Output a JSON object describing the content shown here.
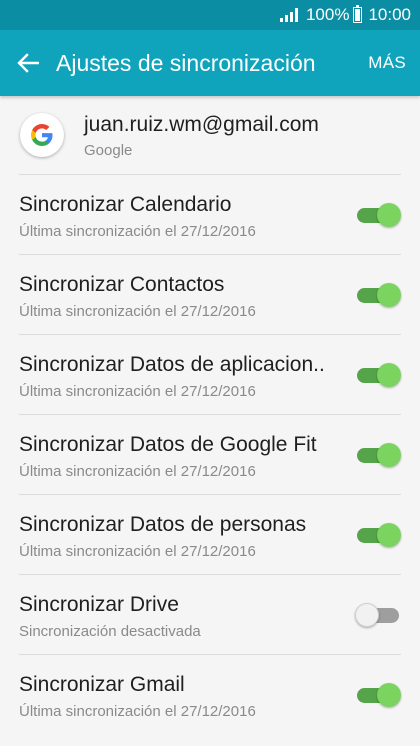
{
  "status_bar": {
    "battery": "100%",
    "time": "10:00"
  },
  "header": {
    "title": "Ajustes de sincronización",
    "more_label": "MÁS"
  },
  "account": {
    "email": "juan.ruiz.wm@gmail.com",
    "provider": "Google"
  },
  "sync_items": [
    {
      "label": "Sincronizar Calendario",
      "status": "Última sincronización el 27/12/2016",
      "enabled": true
    },
    {
      "label": "Sincronizar Contactos",
      "status": "Última sincronización el 27/12/2016",
      "enabled": true
    },
    {
      "label": "Sincronizar Datos de aplicacion..",
      "status": "Última sincronización el 27/12/2016",
      "enabled": true
    },
    {
      "label": "Sincronizar Datos de Google Fit",
      "status": "Última sincronización el 27/12/2016",
      "enabled": true
    },
    {
      "label": "Sincronizar Datos de personas",
      "status": "Última sincronización el 27/12/2016",
      "enabled": true
    },
    {
      "label": "Sincronizar Drive",
      "status": "Sincronización desactivada",
      "enabled": false
    },
    {
      "label": "Sincronizar Gmail",
      "status": "Última sincronización el 27/12/2016",
      "enabled": true
    }
  ],
  "colors": {
    "status_bar": "#0b8ea3",
    "app_bar": "#10a4bc",
    "toggle_on": "#7ad45f"
  }
}
